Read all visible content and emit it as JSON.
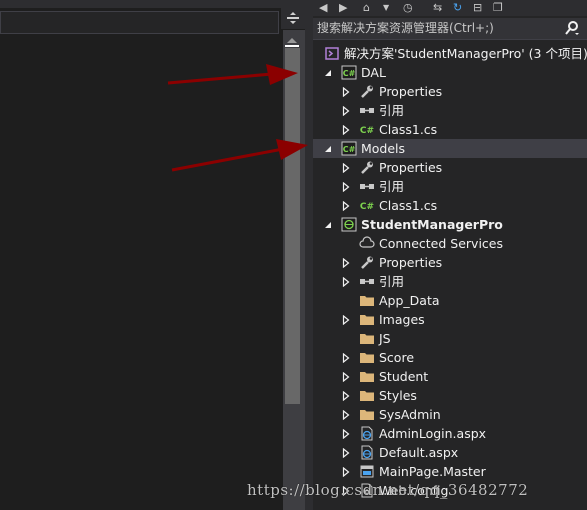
{
  "solution_explorer": {
    "search_placeholder": "搜索解决方案资源管理器(Ctrl+;)",
    "toolbar_icons": [
      "back-icon",
      "forward-icon",
      "home-icon",
      "dropdown-icon",
      "history-icon",
      "sync-icon",
      "refresh-icon",
      "collapse-icon",
      "copy-icon"
    ],
    "tree": [
      {
        "label": "解决方案'StudentManagerPro' (3 个项目)",
        "icon": "solution-icon",
        "indent": 0,
        "expander": "none"
      },
      {
        "label": "DAL",
        "icon": "csharp-project-icon",
        "indent": 1,
        "expander": "expanded"
      },
      {
        "label": "Properties",
        "icon": "wrench-icon",
        "indent": 2,
        "expander": "collapsed"
      },
      {
        "label": "引用",
        "icon": "references-icon",
        "indent": 2,
        "expander": "collapsed"
      },
      {
        "label": "Class1.cs",
        "icon": "csharp-file-icon",
        "indent": 2,
        "expander": "collapsed"
      },
      {
        "label": "Models",
        "icon": "csharp-project-icon",
        "indent": 1,
        "expander": "expanded",
        "selected": true
      },
      {
        "label": "Properties",
        "icon": "wrench-icon",
        "indent": 2,
        "expander": "collapsed"
      },
      {
        "label": "引用",
        "icon": "references-icon",
        "indent": 2,
        "expander": "collapsed"
      },
      {
        "label": "Class1.cs",
        "icon": "csharp-file-icon",
        "indent": 2,
        "expander": "collapsed"
      },
      {
        "label": "StudentManagerPro",
        "icon": "web-project-icon",
        "indent": 1,
        "expander": "expanded",
        "bold": true
      },
      {
        "label": "Connected Services",
        "icon": "cloud-icon",
        "indent": 2,
        "expander": "none"
      },
      {
        "label": "Properties",
        "icon": "wrench-icon",
        "indent": 2,
        "expander": "collapsed"
      },
      {
        "label": "引用",
        "icon": "references-icon",
        "indent": 2,
        "expander": "collapsed"
      },
      {
        "label": "App_Data",
        "icon": "folder-icon",
        "indent": 2,
        "expander": "none"
      },
      {
        "label": "Images",
        "icon": "folder-icon",
        "indent": 2,
        "expander": "collapsed"
      },
      {
        "label": "JS",
        "icon": "folder-icon",
        "indent": 2,
        "expander": "none"
      },
      {
        "label": "Score",
        "icon": "folder-icon",
        "indent": 2,
        "expander": "collapsed"
      },
      {
        "label": "Student",
        "icon": "folder-icon",
        "indent": 2,
        "expander": "collapsed"
      },
      {
        "label": "Styles",
        "icon": "folder-icon",
        "indent": 2,
        "expander": "collapsed"
      },
      {
        "label": "SysAdmin",
        "icon": "folder-icon",
        "indent": 2,
        "expander": "collapsed"
      },
      {
        "label": "AdminLogin.aspx",
        "icon": "aspx-file-icon",
        "indent": 2,
        "expander": "collapsed"
      },
      {
        "label": "Default.aspx",
        "icon": "aspx-file-icon",
        "indent": 2,
        "expander": "collapsed"
      },
      {
        "label": "MainPage.Master",
        "icon": "master-file-icon",
        "indent": 2,
        "expander": "collapsed"
      },
      {
        "label": "Web.config",
        "icon": "config-file-icon",
        "indent": 2,
        "expander": "collapsed"
      }
    ]
  },
  "watermark": "https://blog.csdn.net/qq_36482772",
  "colors": {
    "background": "#1e1e1e",
    "panel": "#252526",
    "selected_row": "#3f3f46",
    "text": "#f1f1f1",
    "folder": "#dcb67a",
    "csharp": "#7ed34f",
    "annotation_arrow": "#8b0000"
  }
}
